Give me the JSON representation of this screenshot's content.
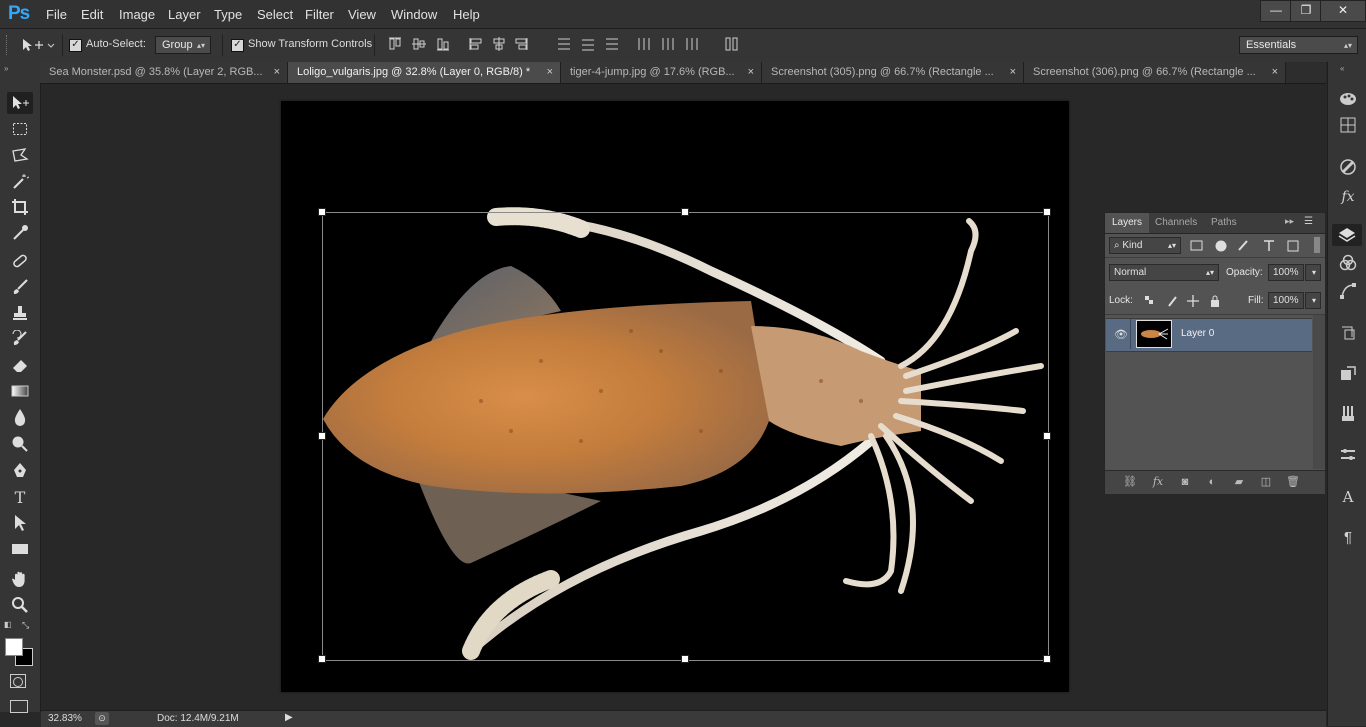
{
  "app": {
    "logo": "Ps",
    "window_buttons": [
      "—",
      "❐",
      "✕"
    ]
  },
  "menu": [
    "File",
    "Edit",
    "Image",
    "Layer",
    "Type",
    "Select",
    "Filter",
    "View",
    "Window",
    "Help"
  ],
  "options": {
    "auto_select_label": "Auto-Select:",
    "auto_select_checked": true,
    "auto_select_value": "Group",
    "show_transform_label": "Show Transform Controls",
    "show_transform_checked": true,
    "workspace": "Essentials"
  },
  "tabs": [
    {
      "label": "Sea Monster.psd @ 35.8% (Layer 2, RGB...",
      "active": false
    },
    {
      "label": "Loligo_vulgaris.jpg @ 32.8% (Layer 0, RGB/8) *",
      "active": true
    },
    {
      "label": "tiger-4-jump.jpg @ 17.6% (RGB...",
      "active": false
    },
    {
      "label": "Screenshot (305).png @ 66.7% (Rectangle ...",
      "active": false
    },
    {
      "label": "Screenshot (306).png @ 66.7% (Rectangle ...",
      "active": false
    }
  ],
  "tab_close": "×",
  "tools": [
    "move-tool",
    "rectangular-marquee-tool",
    "polygonal-lasso-tool",
    "magic-wand-tool",
    "crop-tool",
    "eyedropper-tool",
    "spot-healing-brush-tool",
    "brush-tool",
    "clone-stamp-tool",
    "history-brush-tool",
    "eraser-tool",
    "gradient-tool",
    "blur-tool",
    "dodge-tool",
    "pen-tool",
    "type-tool",
    "path-selection-tool",
    "rectangle-tool",
    "hand-tool",
    "zoom-tool"
  ],
  "colors": {
    "foreground": "#ffffff",
    "background": "#000000",
    "selection_highlight": "#596a83",
    "accent": "#31a8ff"
  },
  "layers_panel": {
    "tabs": [
      "Layers",
      "Channels",
      "Paths"
    ],
    "active_tab": "Layers",
    "filter_kind": "Kind",
    "blend_mode": "Normal",
    "opacity_label": "Opacity:",
    "opacity": "100%",
    "lock_label": "Lock:",
    "fill_label": "Fill:",
    "fill": "100%",
    "layers": [
      {
        "name": "Layer 0",
        "visible": true,
        "selected": true
      }
    ]
  },
  "status": {
    "zoom": "32.83%",
    "doc": "Doc: 12.4M/9.21M"
  },
  "dock_icons": [
    "color-icon",
    "swatches-icon",
    "adjustments-icon",
    "styles-icon",
    "layers-icon",
    "channels-icon",
    "paths-icon",
    "history-icon",
    "properties-icon",
    "brush-presets-icon",
    "character-icon",
    "paragraph-icon",
    "info-icon"
  ]
}
